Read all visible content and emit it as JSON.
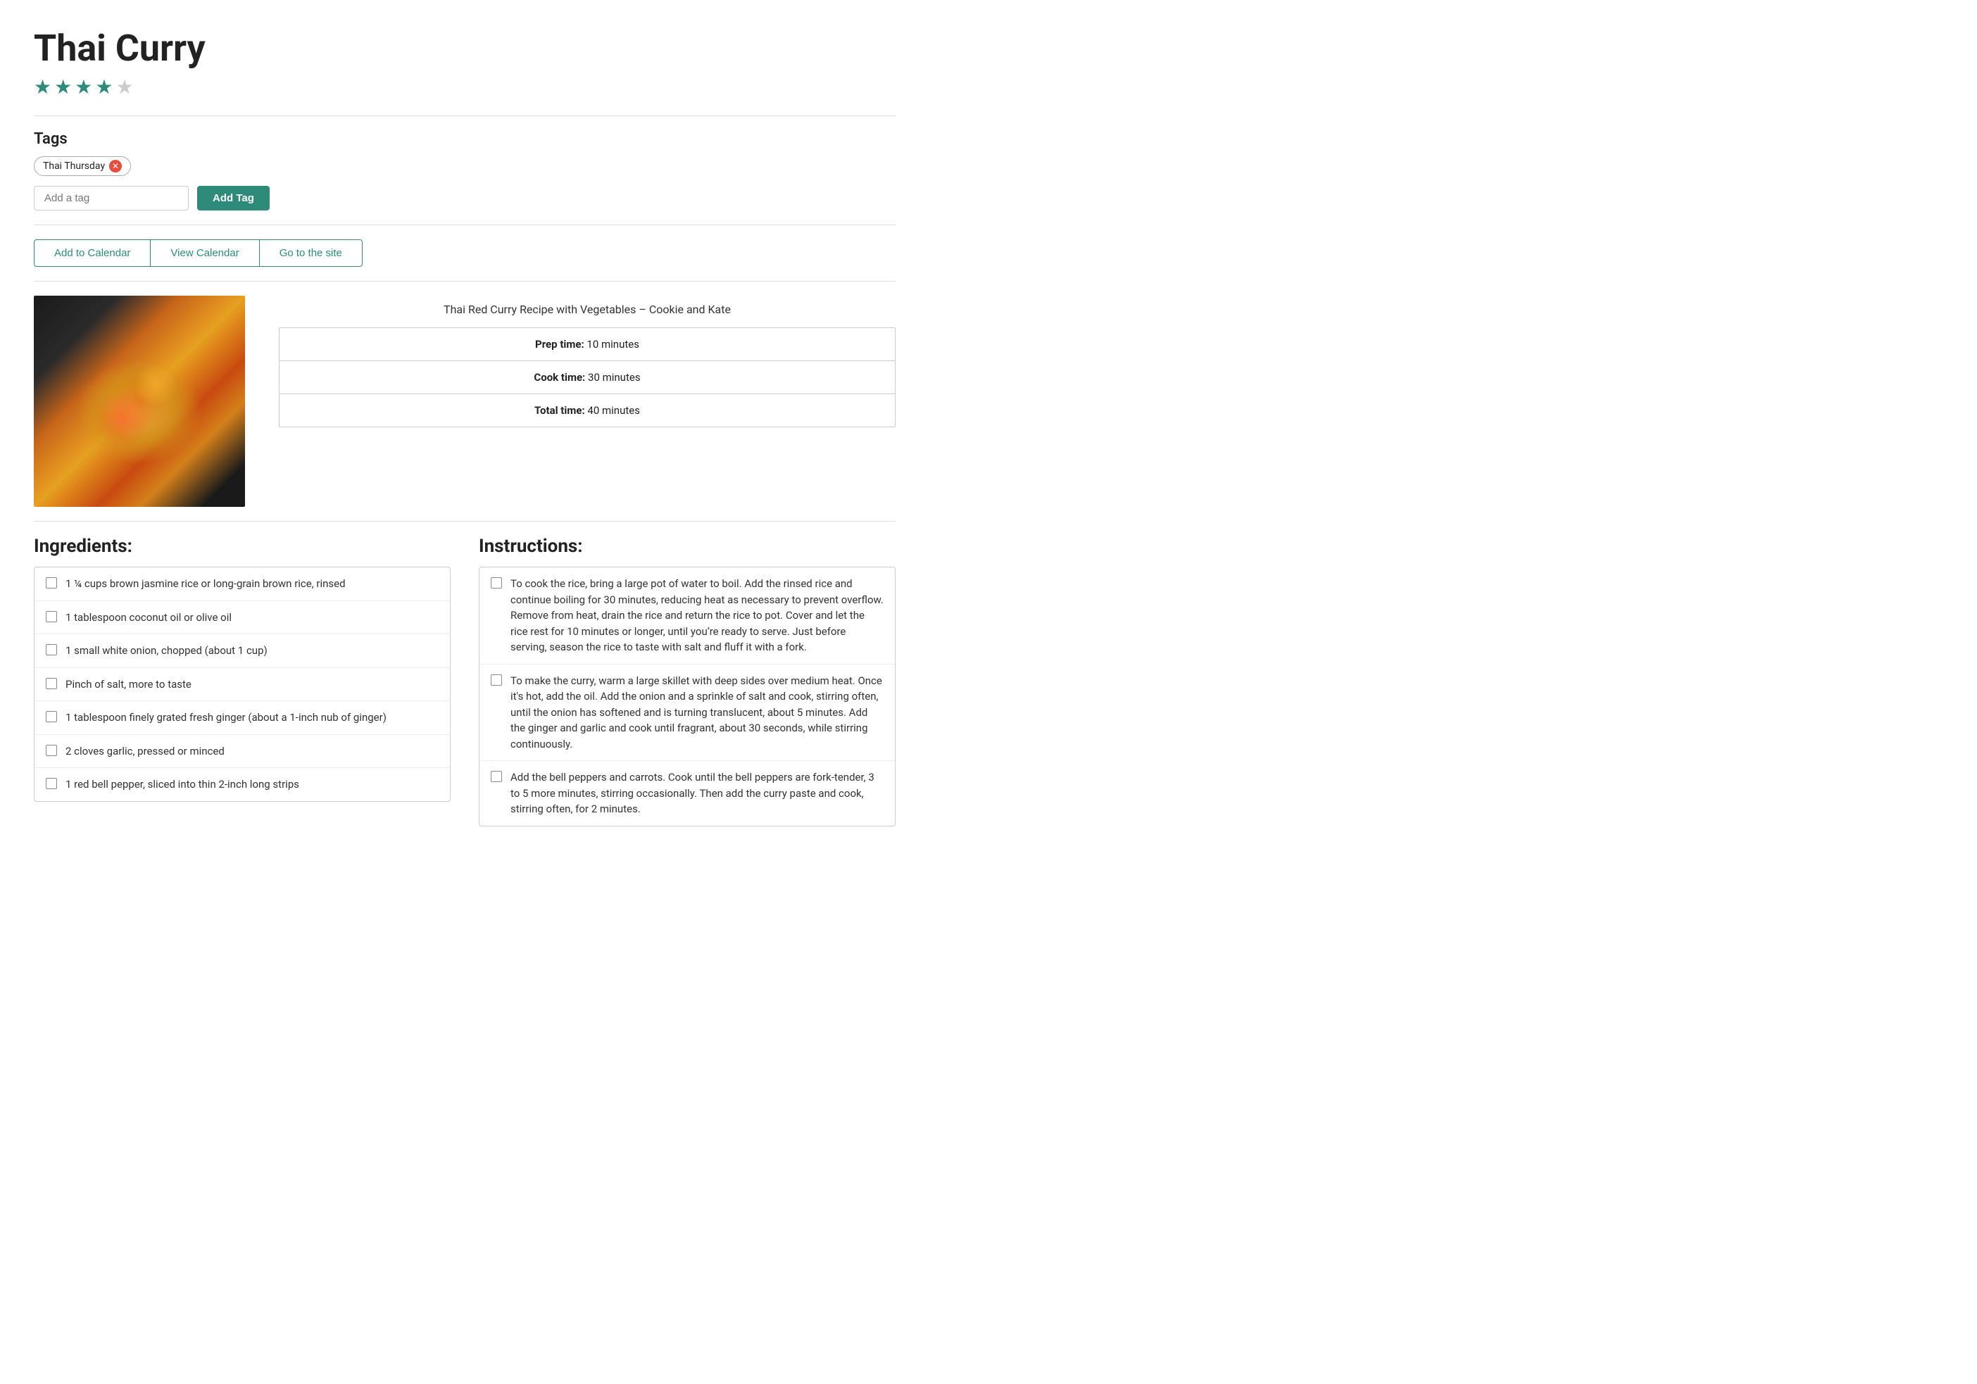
{
  "recipe": {
    "title": "Thai Curry",
    "rating": {
      "filled": 4,
      "empty": 1,
      "total": 5
    },
    "source_title": "Thai Red Curry Recipe with Vegetables – Cookie and Kate"
  },
  "tags": {
    "section_label": "Tags",
    "items": [
      {
        "label": "Thai Thursday",
        "removable": true
      }
    ],
    "add_tag_placeholder": "Add a tag",
    "add_tag_button": "Add Tag"
  },
  "calendar_buttons": [
    {
      "label": "Add to Calendar",
      "name": "add-to-calendar-btn"
    },
    {
      "label": "View Calendar",
      "name": "view-calendar-btn"
    },
    {
      "label": "Go to the site",
      "name": "go-to-site-btn"
    }
  ],
  "times": {
    "prep": {
      "label": "Prep time:",
      "value": "10 minutes"
    },
    "cook": {
      "label": "Cook time:",
      "value": "30 minutes"
    },
    "total": {
      "label": "Total time:",
      "value": "40 minutes"
    }
  },
  "ingredients": {
    "section_label": "Ingredients:",
    "items": [
      "1 ¼ cups brown jasmine rice or long-grain brown rice, rinsed",
      "1 tablespoon coconut oil or olive oil",
      "1 small white onion, chopped (about 1 cup)",
      "Pinch of salt, more to taste",
      "1 tablespoon finely grated fresh ginger (about a 1-inch nub of ginger)",
      "2 cloves garlic, pressed or minced",
      "1 red bell pepper, sliced into thin 2-inch long strips"
    ]
  },
  "instructions": {
    "section_label": "Instructions:",
    "items": [
      "To cook the rice, bring a large pot of water to boil. Add the rinsed rice and continue boiling for 30 minutes, reducing heat as necessary to prevent overflow. Remove from heat, drain the rice and return the rice to pot. Cover and let the rice rest for 10 minutes or longer, until you&#8217;re ready to serve. Just before serving, season the rice to taste with salt and fluff it with a fork.",
      "To make the curry, warm a large skillet with deep sides over medium heat. Once it's hot, add the oil. Add the onion and a sprinkle of salt and cook, stirring often, until the onion has softened and is turning translucent, about 5 minutes. Add the ginger and garlic and cook until fragrant, about 30 seconds, while stirring continuously.",
      "Add the bell peppers and carrots. Cook until the bell peppers are fork-tender, 3 to 5 more minutes, stirring occasionally. Then add the curry paste and cook, stirring often, for 2 minutes."
    ]
  },
  "colors": {
    "accent": "#2e8b7a",
    "star_filled": "#2e8b7a",
    "star_empty": "#ccc",
    "tag_remove": "#e74c3c"
  }
}
